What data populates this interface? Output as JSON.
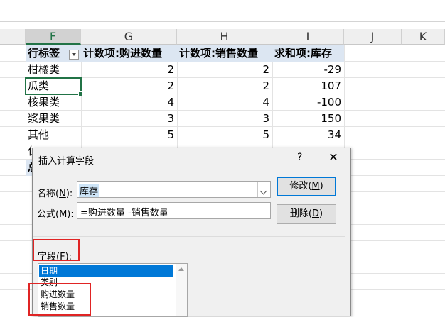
{
  "columns": [
    "F",
    "G",
    "H",
    "I",
    "J",
    "K"
  ],
  "pivot": {
    "headers": [
      "行标签",
      "计数项:购进数量",
      "计数项:销售数量",
      "求和项:库存"
    ],
    "rows": [
      {
        "label": "柑橘类",
        "g": "2",
        "h": "2",
        "i": "-29"
      },
      {
        "label": "瓜类",
        "g": "2",
        "h": "2",
        "i": "107"
      },
      {
        "label": "核果类",
        "g": "4",
        "h": "4",
        "i": "-100"
      },
      {
        "label": "浆果类",
        "g": "3",
        "h": "3",
        "i": "150"
      },
      {
        "label": "其他",
        "g": "5",
        "h": "5",
        "i": "34"
      }
    ],
    "partial_row_label": "仁",
    "partial_total_label": "总"
  },
  "dialog": {
    "title": "插入计算字段",
    "help": "?",
    "close": "✕",
    "name_label": "名称(",
    "name_key": "N",
    "name_label_end": "):",
    "name_value": "库存",
    "formula_label": "公式(",
    "formula_key": "M",
    "formula_label_end": "):",
    "formula_value": "=购进数量 -销售数量",
    "modify_label": "修改(",
    "modify_key": "M",
    "modify_end": ")",
    "delete_label": "删除(",
    "delete_key": "D",
    "delete_end": ")",
    "fields_label": "字段(",
    "fields_key": "F",
    "fields_label_end": "):",
    "fields": [
      "日期",
      "类别",
      "购进数量",
      "销售数量"
    ],
    "selected_field": "日期"
  },
  "colors": {
    "accent": "#217346",
    "selection": "#0078d7",
    "highlight": "#e02424",
    "pivot_header": "#dce6f2"
  }
}
